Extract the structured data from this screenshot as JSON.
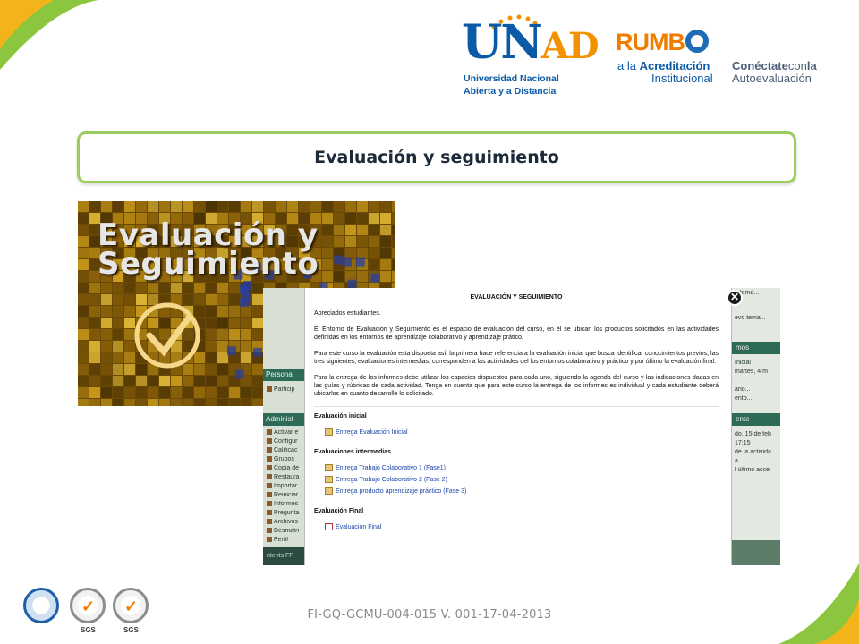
{
  "colors": {
    "title_border": "#9acd5c",
    "corner_green": "#8cc63f",
    "unad_blue": "#0b5aa6",
    "orange": "#f29200",
    "moodle_green": "#2e6b56"
  },
  "logos": {
    "unad_mark_u": "U",
    "unad_mark_n": "N",
    "unad_mark_ad": "AD",
    "unad_line1": "Universidad Nacional",
    "unad_line2": "Abierta y a Distancia",
    "rumbo_word": "RUMB",
    "rumbo_line1_a": "a la ",
    "rumbo_line1_b": "Acreditación",
    "rumbo_line2": "Institucional",
    "conecta_line1_a": "Conéctate",
    "conecta_line1_b": "con",
    "conecta_line1_c": "la",
    "conecta_line2": "Autoevaluación"
  },
  "slide": {
    "title": "Evaluación y seguimiento"
  },
  "banner": {
    "line1": "Evaluación y",
    "line2": "Seguimiento"
  },
  "screenshot": {
    "left_panel": {
      "block1_title": "Persona",
      "block1_item": "Particip",
      "block2_title": "Administ",
      "items": [
        "Activar e",
        "Configur",
        "Calificac",
        "Grupos",
        "Copia de",
        "Restaura",
        "Importar",
        "Reiniciar",
        "Informes",
        "Pregunta",
        "Archivos",
        "Desmatri",
        "Perfil"
      ],
      "footer": "ntents FF"
    },
    "right_panel": {
      "top_text": "n tema...",
      "item1": "evo tema...",
      "block1_title": "mos",
      "lines1": [
        "Inicial",
        "martes, 4 m",
        "",
        "ario...",
        "ento..."
      ],
      "block2_title": "ente",
      "lines2": [
        "do, 15 de feb",
        "17:15",
        "de la activida",
        "a...",
        "l último acce"
      ]
    },
    "modal": {
      "heading": "EVALUACIÓN Y SEGUIMIENTO",
      "greeting": "Apreciados estudiantes.",
      "para1": "El Entorno de Evaluación y Seguimiento es el espacio de evaluación del curso, en él se ubican los productos solicitados en las actividades definidas en los entornos de aprendizaje colaborativo y aprendizaje prático.",
      "para2": "Para este curso la evaluación esta dispueta así: la primera hace referencia a la evaluación inicial que busca identificar conocimientos previos; las tres siguientes, evaluaciones intermedias, corresponden a las actividades del los entornos colaborativo y práctico y por último la evaluación final.",
      "para3": "Para la entrega de los informes debe utilizar los espacios dispuestos para cada uno, siguiendo la agenda del curso y las indicaciones dadas en las guías y rúbricas de cada actividad. Tenga en cuenta que para este curso la entrega de los informes es individual y cada estudiante deberá ubicarlos en cuanto desarrolle lo solicitado.",
      "sec1_title": "Evaluación inicial",
      "sec1_links": [
        "Entrega Evaluación Inicial"
      ],
      "sec2_title": "Evaluaciones intermedias",
      "sec2_links": [
        "Entrega Trabajo Colaborativo 1 (Fase1)",
        "Entrega Trabajo Colaborativo 2 (Fase 2)",
        "Entrega producto aprendizaje práctico (Fase 3)"
      ],
      "sec3_title": "Evaluación Final",
      "sec3_links": [
        "Evaluación Final"
      ],
      "close_symbol": "✕"
    }
  },
  "footer": {
    "code": "FI-GQ-GCMU-004-015 V. 001-17-04-2013",
    "cert_label_1": "SGS",
    "cert_label_2": "SGS",
    "check_symbol": "✓"
  }
}
